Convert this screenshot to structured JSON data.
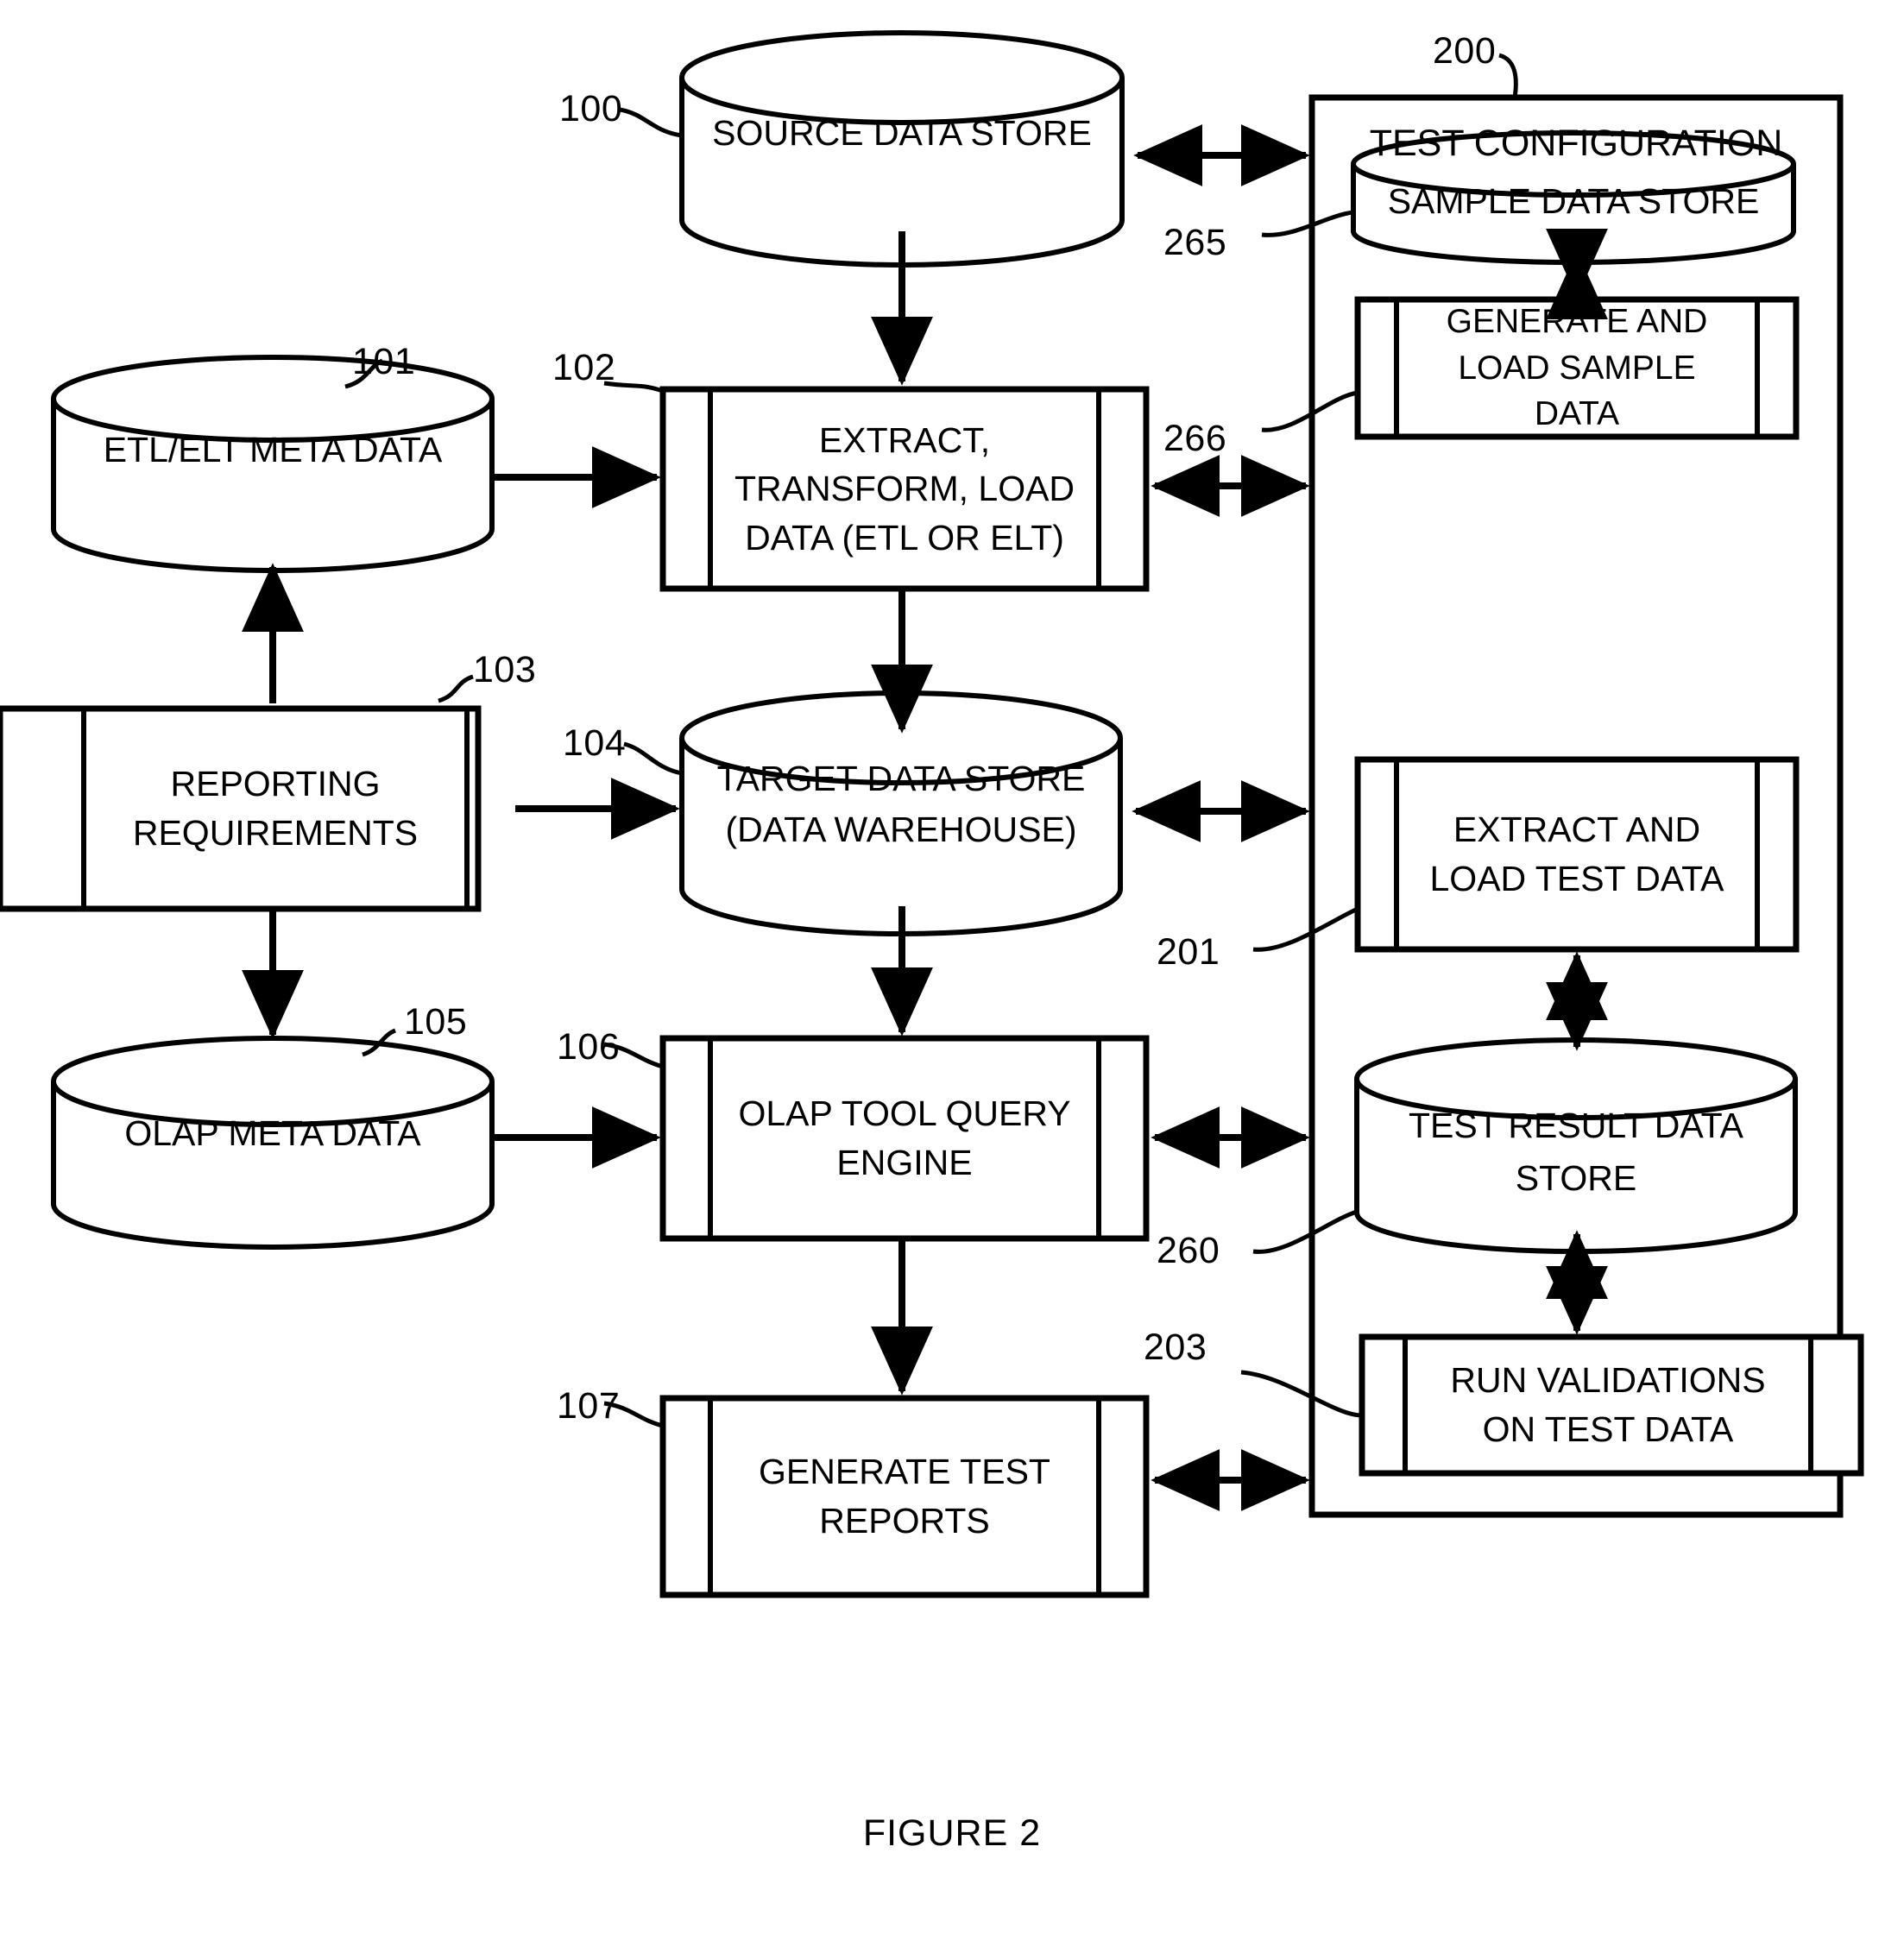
{
  "figure": {
    "caption": "FIGURE 2"
  },
  "frame": {
    "title": "TEST CONFIGURATION",
    "ref": "200"
  },
  "left_flow": {
    "nodes": [
      {
        "ref": "100",
        "label": "SOURCE DATA STORE",
        "shape": "cylinder"
      },
      {
        "ref": "101",
        "label": "ETL/ELT META DATA",
        "shape": "cylinder"
      },
      {
        "ref": "102",
        "label": "EXTRACT,\nTRANSFORM, LOAD\nDATA (ETL OR ELT)",
        "shape": "process"
      },
      {
        "ref": "103",
        "label": "REPORTING\nREQUIREMENTS",
        "shape": "process"
      },
      {
        "ref": "104",
        "label": "TARGET DATA STORE\n(DATA WAREHOUSE)",
        "shape": "cylinder"
      },
      {
        "ref": "105",
        "label": "OLAP META DATA",
        "shape": "cylinder"
      },
      {
        "ref": "106",
        "label": "OLAP TOOL QUERY\nENGINE",
        "shape": "process"
      },
      {
        "ref": "107",
        "label": "GENERATE TEST\nREPORTS",
        "shape": "process"
      }
    ]
  },
  "test_configuration": {
    "nodes": [
      {
        "ref": "265",
        "label": "SAMPLE DATA STORE",
        "shape": "cylinder"
      },
      {
        "ref": "266",
        "label": "GENERATE AND\nLOAD SAMPLE\nDATA",
        "shape": "process"
      },
      {
        "ref": "201",
        "label": "EXTRACT AND\nLOAD TEST DATA",
        "shape": "process"
      },
      {
        "ref": "260",
        "label": "TEST RESULT DATA\nSTORE",
        "shape": "cylinder"
      },
      {
        "ref": "203",
        "label": "RUN VALIDATIONS\nON TEST DATA",
        "shape": "process"
      }
    ]
  },
  "connections": [
    {
      "from": "100",
      "to": "frame",
      "kind": "double-arrow",
      "orientation": "horizontal"
    },
    {
      "from": "100",
      "to": "102",
      "kind": "arrow",
      "orientation": "vertical"
    },
    {
      "from": "101",
      "to": "102",
      "kind": "arrow",
      "orientation": "horizontal"
    },
    {
      "from": "102",
      "to": "104",
      "kind": "arrow",
      "orientation": "vertical"
    },
    {
      "from": "102",
      "to": "frame",
      "kind": "double-arrow",
      "orientation": "horizontal"
    },
    {
      "from": "103",
      "to": "101",
      "kind": "arrow",
      "orientation": "vertical"
    },
    {
      "from": "103",
      "to": "104",
      "kind": "arrow",
      "orientation": "horizontal"
    },
    {
      "from": "103",
      "to": "105",
      "kind": "arrow",
      "orientation": "vertical"
    },
    {
      "from": "104",
      "to": "106",
      "kind": "arrow",
      "orientation": "vertical"
    },
    {
      "from": "104",
      "to": "frame",
      "kind": "double-arrow",
      "orientation": "horizontal"
    },
    {
      "from": "105",
      "to": "106",
      "kind": "arrow",
      "orientation": "horizontal"
    },
    {
      "from": "106",
      "to": "107",
      "kind": "arrow",
      "orientation": "vertical"
    },
    {
      "from": "106",
      "to": "frame",
      "kind": "double-arrow",
      "orientation": "horizontal"
    },
    {
      "from": "107",
      "to": "frame",
      "kind": "double-arrow",
      "orientation": "horizontal"
    },
    {
      "from": "265",
      "to": "266",
      "kind": "double-arrow",
      "orientation": "vertical"
    },
    {
      "from": "201",
      "to": "260",
      "kind": "double-arrow",
      "orientation": "vertical"
    },
    {
      "from": "260",
      "to": "203",
      "kind": "double-arrow",
      "orientation": "vertical"
    }
  ],
  "colors": {
    "stroke": "#000000",
    "background": "#ffffff"
  }
}
